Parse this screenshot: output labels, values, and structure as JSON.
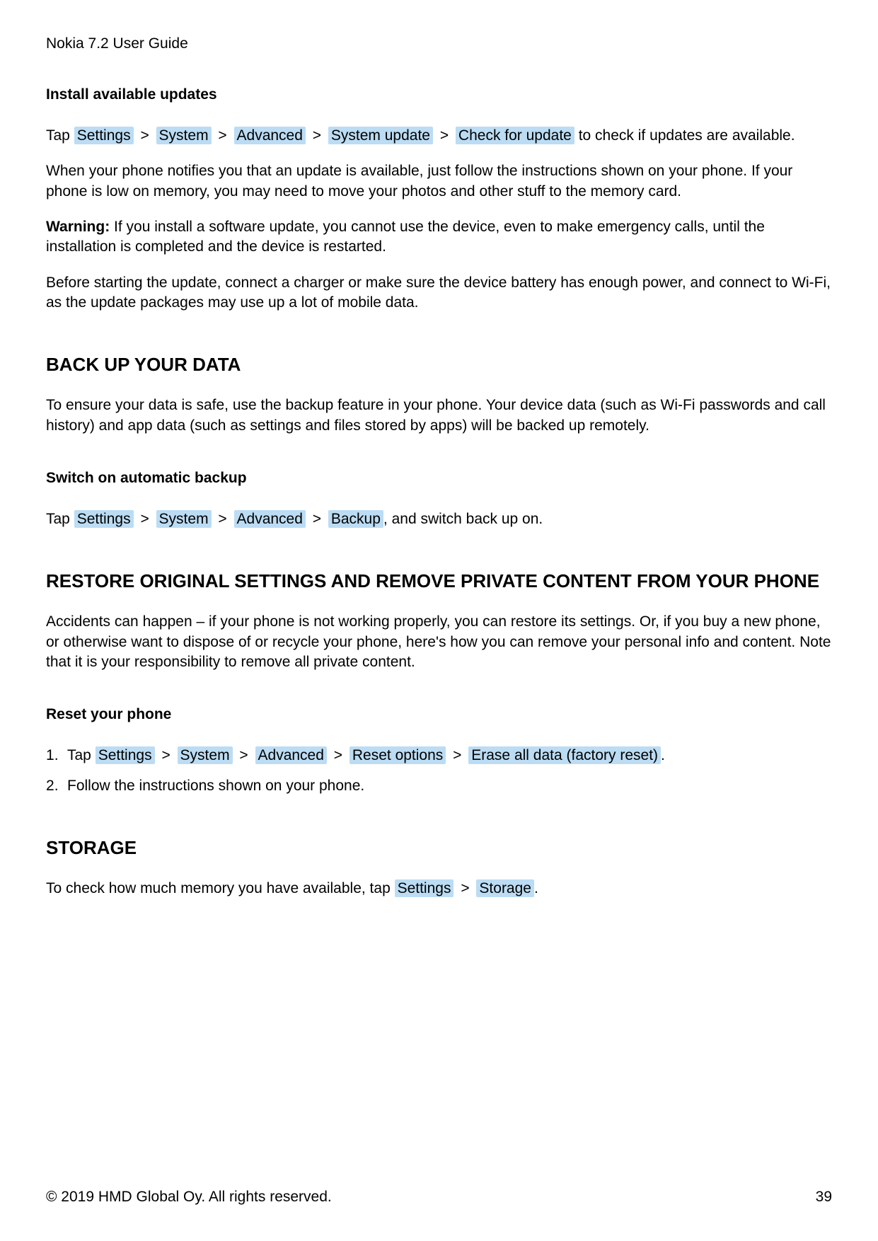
{
  "header": {
    "title": "Nokia 7.2 User Guide"
  },
  "sections": {
    "install_updates": {
      "title": "Install available updates",
      "tap_prefix": "Tap ",
      "path": {
        "settings": "Settings",
        "system": "System",
        "advanced": "Advanced",
        "system_update": "System update",
        "check_update": "Check for update"
      },
      "tap_suffix": " to check if updates are available.",
      "sep": ">",
      "para2": "When your phone notifies you that an update is available, just follow the instructions shown on your phone. If your phone is low on memory, you may need to move your photos and other stuff to the memory card.",
      "warning_label": "Warning:",
      "warning_text": " If you install a software update, you cannot use the device, even to make emergency calls, until the installation is completed and the device is restarted.",
      "para4": "Before starting the update, connect a charger or make sure the device battery has enough power, and connect to Wi-Fi, as the update packages may use up a lot of mobile data."
    },
    "backup": {
      "title": "BACK UP YOUR DATA",
      "para1": "To ensure your data is safe, use the backup feature in your phone. Your device data (such as Wi-Fi passwords and call history) and app data (such as settings and files stored by apps) will be backed up remotely.",
      "sub_title": "Switch on automatic backup",
      "tap_prefix": "Tap ",
      "path": {
        "settings": "Settings",
        "system": "System",
        "advanced": "Advanced",
        "backup": "Backup"
      },
      "tap_suffix": ", and switch back up on.",
      "sep": ">"
    },
    "restore": {
      "title": "RESTORE ORIGINAL SETTINGS AND REMOVE PRIVATE CONTENT FROM YOUR PHONE",
      "para1": "Accidents can happen – if your phone is not working properly, you can restore its settings. Or, if you buy a new phone, or otherwise want to dispose of or recycle your phone, here's how you can remove your personal info and content. Note that it is your responsibility to remove all private content.",
      "sub_title": "Reset your phone",
      "step1_prefix": "Tap ",
      "step1_path": {
        "settings": "Settings",
        "system": "System",
        "advanced": "Advanced",
        "reset_options": "Reset options",
        "erase_all": "Erase all data (factory reset)"
      },
      "step1_suffix": ".",
      "sep": ">",
      "step2": "Follow the instructions shown on your phone."
    },
    "storage": {
      "title": "STORAGE",
      "para_prefix": "To check how much memory you have available, tap ",
      "path": {
        "settings": "Settings",
        "storage": "Storage"
      },
      "para_suffix": ".",
      "sep": ">"
    }
  },
  "footer": {
    "copyright": "© 2019 HMD Global Oy. All rights reserved.",
    "page_number": "39"
  }
}
